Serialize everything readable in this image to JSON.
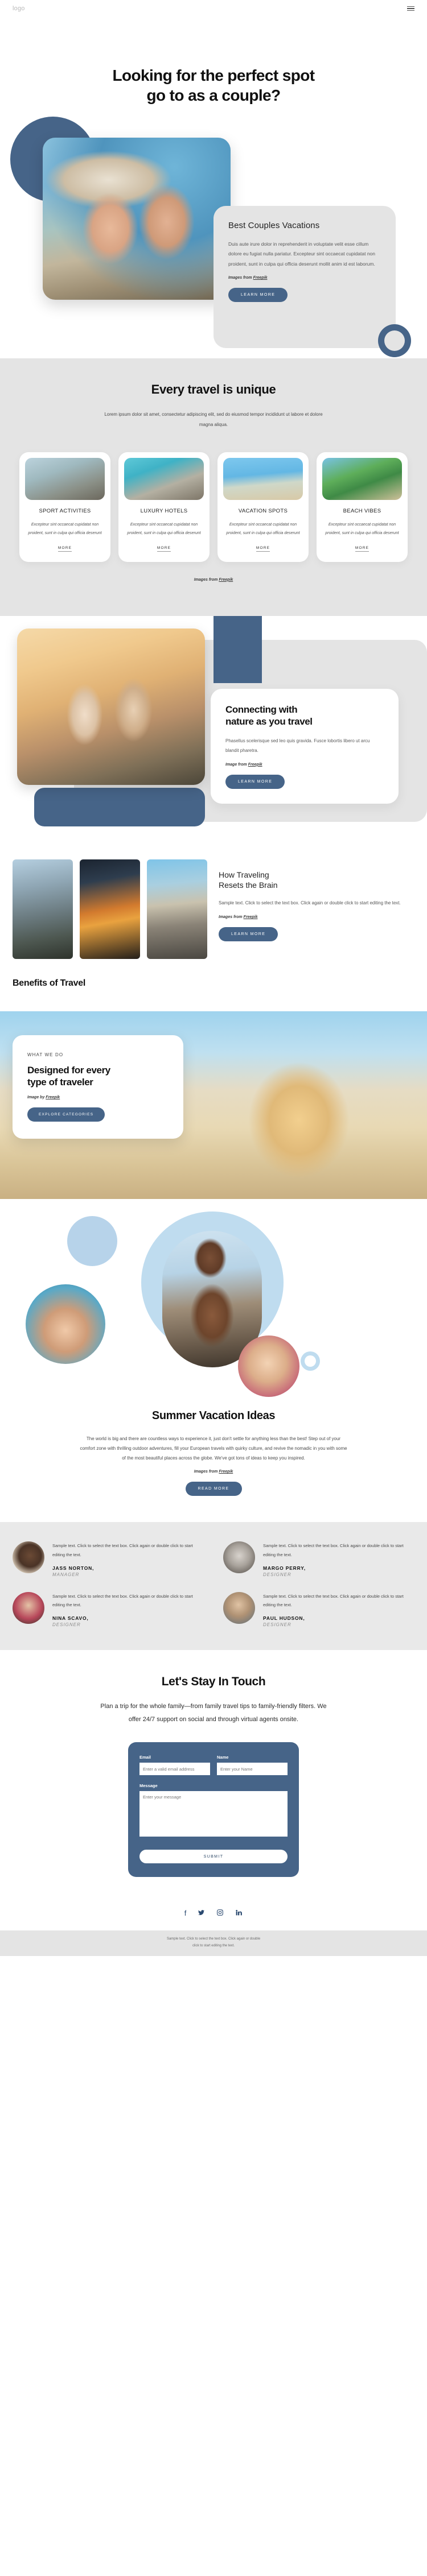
{
  "header": {
    "logo": "logo",
    "menu_icon": "hamburger-menu-icon"
  },
  "hero": {
    "title_line1": "Looking for the perfect spot",
    "title_line2": "go to as a couple?",
    "card": {
      "heading": "Best Couples Vacations",
      "body": "Duis aute irure dolor in reprehenderit in voluptate velit esse cillum dolore eu fugiat nulla pariatur. Excepteur sint occaecat cupidatat non proident, sunt in culpa qui officia deserunt mollit anim id est laborum.",
      "credit_prefix": "Images from ",
      "credit_link": "Freepik",
      "button": "LEARN MORE"
    }
  },
  "unique": {
    "title": "Every travel is unique",
    "subtitle": "Lorem ipsum dolor sit amet, consectetur adipiscing elit, sed do eiusmod tempor incididunt ut labore et dolore magna aliqua.",
    "cards": [
      {
        "title": "SPORT ACTIVITIES",
        "body": "Excepteur sint occaecat cupidatat non proident, sunt in culpa qui officia deserunt",
        "more": "MORE"
      },
      {
        "title": "LUXURY HOTELS",
        "body": "Excepteur sint occaecat cupidatat non proident, sunt in culpa qui officia deserunt",
        "more": "MORE"
      },
      {
        "title": "VACATION SPOTS",
        "body": "Excepteur sint occaecat cupidatat non proident, sunt in culpa qui officia deserunt",
        "more": "MORE"
      },
      {
        "title": "BEACH VIBES",
        "body": "Excepteur sint occaecat cupidatat non proident, sunt in culpa qui officia deserunt",
        "more": "MORE"
      }
    ],
    "credit_prefix": "Images from ",
    "credit_link": "Freepik"
  },
  "nature": {
    "heading_line1": "Connecting with",
    "heading_line2": "nature as you travel",
    "body": "Phasellus scelerisque sed leo quis gravida. Fusce lobortis libero ut arcu blandit pharetra.",
    "credit_prefix": "Image from ",
    "credit_link": "Freepik",
    "button": "LEARN MORE"
  },
  "brain": {
    "heading_line1": "How Traveling",
    "heading_line2": "Resets the Brain",
    "body": "Sample text. Click to select the text box. Click again or double click to start editing the text.",
    "credit_prefix": "Images from ",
    "credit_link": "Freepik",
    "button": "LEARN MORE",
    "benefits_title": "Benefits of Travel"
  },
  "designed": {
    "eyebrow": "WHAT WE DO",
    "heading_line1": "Designed for every",
    "heading_line2": "type of traveler",
    "credit_prefix": "Image by ",
    "credit_link": "Freepik",
    "button": "EXPLORE CATEGORIES"
  },
  "summer": {
    "title": "Summer Vacation Ideas",
    "body": "The world is big and there are countless ways to experience it, just don't settle for anything less than the best! Step out of your comfort zone with thrilling outdoor adventures, fill your European travels with quirky culture, and revive the nomadic in you with some of the most beautiful places across the globe. We've got tons of ideas to keep you inspired.",
    "credit_prefix": "Images from ",
    "credit_link": "Freepik",
    "button": "READ MORE"
  },
  "testimonials": [
    {
      "quote": "Sample text. Click to select the text box. Click again or double click to start editing the text.",
      "name": "JASS NORTON,",
      "role": "MANAGER"
    },
    {
      "quote": "Sample text. Click to select the text box. Click again or double click to start editing the text.",
      "name": "MARGO PERRY,",
      "role": "DESIGNER"
    },
    {
      "quote": "Sample text. Click to select the text box. Click again or double click to start editing the text.",
      "name": "NINA SCAVO,",
      "role": "DESIGNER"
    },
    {
      "quote": "Sample text. Click to select the text box. Click again or double click to start editing the text.",
      "name": "PAUL HUDSON,",
      "role": "DESIGNER"
    }
  ],
  "contact": {
    "title": "Let's Stay In Touch",
    "body": "Plan a trip for the whole family—from family travel tips to family-friendly filters. We offer 24/7 support on social and through virtual agents onsite.",
    "form": {
      "email_label": "Email",
      "email_placeholder": "Enter a valid email address",
      "name_label": "Name",
      "name_placeholder": "Enter your Name",
      "message_label": "Message",
      "message_placeholder": "Enter your message",
      "submit": "SUBMIT"
    }
  },
  "social": [
    {
      "icon": "facebook-icon",
      "glyph": "f"
    },
    {
      "icon": "twitter-icon",
      "glyph": "ᵗ"
    },
    {
      "icon": "instagram-icon",
      "glyph": "▣"
    },
    {
      "icon": "linkedin-icon",
      "glyph": "in"
    }
  ],
  "footer": {
    "line1": "Sample text. Click to select the text box. Click again or double",
    "line2": "click to start editing the text."
  },
  "colors": {
    "accent": "#466488",
    "grey_bg": "#e4e4e4",
    "testimonial_bg": "#e9e9e9"
  }
}
